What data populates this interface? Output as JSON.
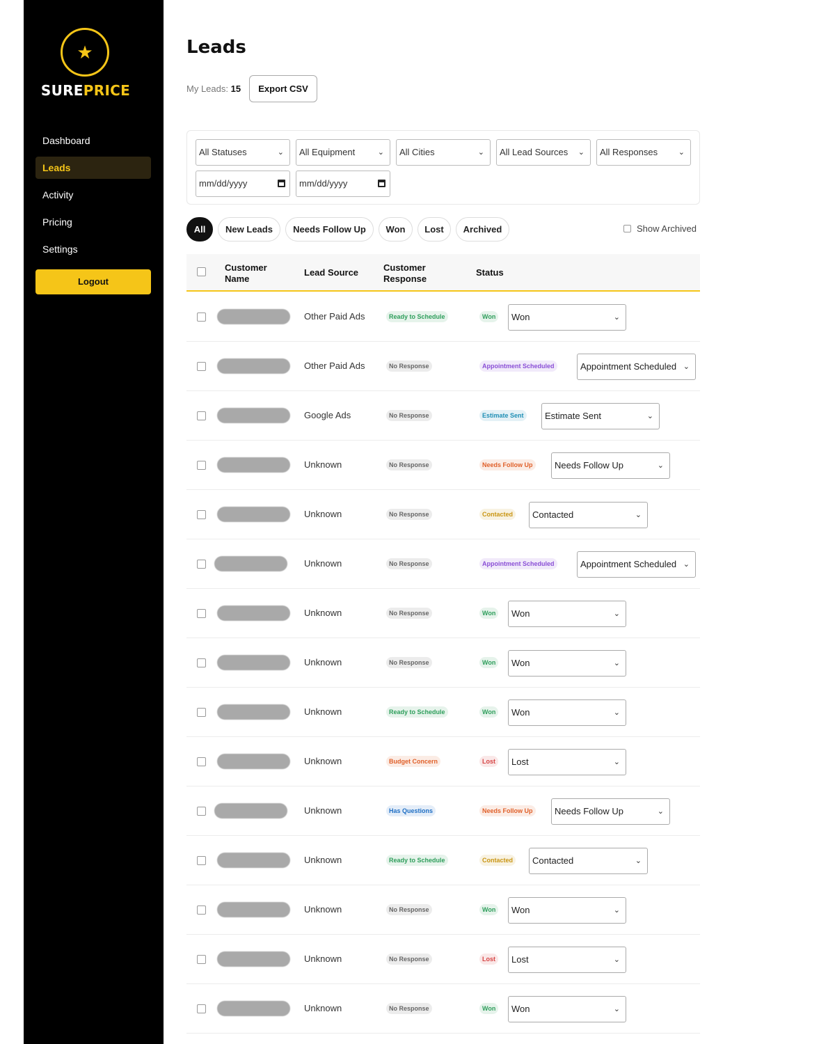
{
  "brand": {
    "name_part1": "SURE",
    "name_part2": "PRICE",
    "logo_icon": "star-icon"
  },
  "sidebar": {
    "items": [
      {
        "label": "Dashboard"
      },
      {
        "label": "Leads"
      },
      {
        "label": "Activity"
      },
      {
        "label": "Pricing"
      },
      {
        "label": "Settings"
      }
    ],
    "logout_label": "Logout"
  },
  "page": {
    "title": "Leads",
    "count_label": "My Leads:",
    "count": "15",
    "export_label": "Export CSV"
  },
  "filters": {
    "status": "All Statuses",
    "equipment": "All Equipment",
    "cities": "All Cities",
    "lead_sources": "All Lead Sources",
    "responses": "All Responses",
    "date_from_placeholder": "mm/dd/yyyy",
    "date_to_placeholder": "mm/dd/yyyy"
  },
  "tabs": [
    {
      "label": "All"
    },
    {
      "label": "New Leads"
    },
    {
      "label": "Needs Follow Up"
    },
    {
      "label": "Won"
    },
    {
      "label": "Lost"
    },
    {
      "label": "Archived"
    }
  ],
  "show_archived_label": "Show Archived",
  "table": {
    "headers": {
      "customer_name_1": "Customer",
      "customer_name_2": "Name",
      "lead_source": "Lead Source",
      "customer_response_1": "Customer",
      "customer_response_2": "Response",
      "status": "Status"
    },
    "rows": [
      {
        "source": "Other Paid Ads",
        "response": "Ready to Schedule",
        "status": "Won",
        "select": "Won"
      },
      {
        "source": "Other Paid Ads",
        "response": "No Response",
        "status": "Appointment Scheduled",
        "select": "Appointment Scheduled"
      },
      {
        "source": "Google Ads",
        "response": "No Response",
        "status": "Estimate Sent",
        "select": "Estimate Sent"
      },
      {
        "source": "Unknown",
        "response": "No Response",
        "status": "Needs Follow Up",
        "select": "Needs Follow Up"
      },
      {
        "source": "Unknown",
        "response": "No Response",
        "status": "Contacted",
        "select": "Contacted"
      },
      {
        "source": "Unknown",
        "response": "No Response",
        "status": "Appointment Scheduled",
        "select": "Appointment Scheduled"
      },
      {
        "source": "Unknown",
        "response": "No Response",
        "status": "Won",
        "select": "Won"
      },
      {
        "source": "Unknown",
        "response": "No Response",
        "status": "Won",
        "select": "Won"
      },
      {
        "source": "Unknown",
        "response": "Ready to Schedule",
        "status": "Won",
        "select": "Won"
      },
      {
        "source": "Unknown",
        "response": "Budget Concern",
        "status": "Lost",
        "select": "Lost"
      },
      {
        "source": "Unknown",
        "response": "Has Questions",
        "status": "Needs Follow Up",
        "select": "Needs Follow Up"
      },
      {
        "source": "Unknown",
        "response": "Ready to Schedule",
        "status": "Contacted",
        "select": "Contacted"
      },
      {
        "source": "Unknown",
        "response": "No Response",
        "status": "Won",
        "select": "Won"
      },
      {
        "source": "Unknown",
        "response": "No Response",
        "status": "Lost",
        "select": "Lost"
      },
      {
        "source": "Unknown",
        "response": "No Response",
        "status": "Won",
        "select": "Won"
      }
    ]
  },
  "colors": {
    "accent": "#f5c518",
    "sidebar_bg": "#000000",
    "won": "#2e9e5b",
    "appointment_scheduled": "#8a4fd6",
    "estimate_sent": "#1f8fb5",
    "needs_follow_up": "#e0602a",
    "contacted": "#c99513",
    "lost": "#d64545",
    "ready_to_schedule": "#2e9e5b",
    "no_response": "#666666",
    "budget_concern": "#e0602a",
    "has_questions": "#1f6fc4"
  }
}
